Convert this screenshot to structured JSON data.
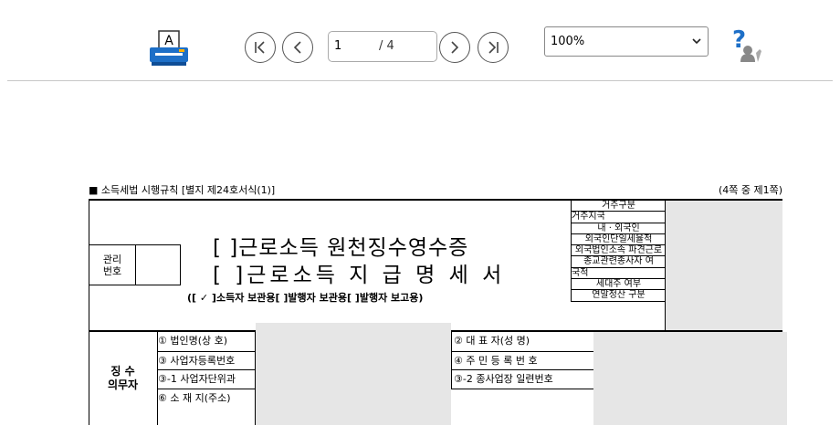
{
  "toolbar": {
    "printer_icon_letter": "A",
    "page_current": "1",
    "page_total": "/ 4",
    "zoom_value": "100%",
    "help_symbol": "?"
  },
  "document": {
    "header_left": "■ 소득세법 시행규칙 [별지 제24호서식(1)]",
    "header_right": "(4쪽 중 제1쪽)",
    "mgmt_label_1": "관리",
    "mgmt_label_2": "번호",
    "title_line1": "[  ]근로소득 원천징수영수증",
    "title_line2": "[  ]근로소득 지 급 명 세 서",
    "subtitle": "([ ✓ ]소득자 보관용[   ]발행자 보관용[   ]발행자 보고용)",
    "right_table": [
      "거주구분",
      "거주지국",
      "내 · 외국인",
      "외국인단일세율적",
      "외국법인소속 파견근로",
      "종교관련종사자 여",
      "국적",
      "세대주 여부",
      "연말정산 구분"
    ],
    "collector_1": "징 수",
    "collector_2": "의무자",
    "rows_left": [
      "① 법인명(상  호)",
      "③ 사업자등록번호",
      "③-1 사업자단위과",
      "⑥ 소 재 지(주소)"
    ],
    "rows_right": [
      "② 대 표 자(성   명)",
      "④ 주 민 등 록 번 호",
      "③-2 종사업장 일련번호"
    ]
  }
}
